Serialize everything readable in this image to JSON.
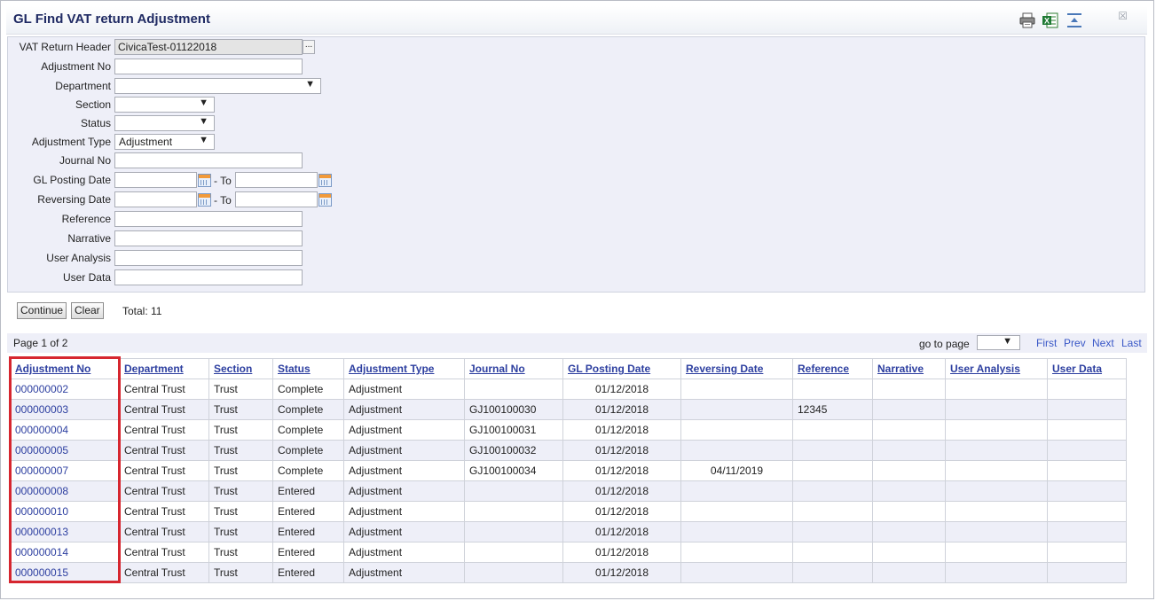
{
  "window": {
    "title": "GL Find VAT return Adjustment",
    "close_label": "☒"
  },
  "toolbar": {
    "icons": [
      "printer-icon",
      "excel-export-icon",
      "collapse-icon"
    ]
  },
  "form": {
    "vat_return_header": {
      "label": "VAT Return Header",
      "value": "CivicaTest-01122018",
      "lookup_label": "..."
    },
    "adjustment_no": {
      "label": "Adjustment No",
      "value": ""
    },
    "department": {
      "label": "Department",
      "value": ""
    },
    "section": {
      "label": "Section",
      "value": ""
    },
    "status": {
      "label": "Status",
      "value": ""
    },
    "adjustment_type": {
      "label": "Adjustment Type",
      "value": "Adjustment"
    },
    "journal_no": {
      "label": "Journal No",
      "value": ""
    },
    "gl_posting_date": {
      "label": "GL Posting Date",
      "from": "",
      "to_label": "- To",
      "to": ""
    },
    "reversing_date": {
      "label": "Reversing Date",
      "from": "",
      "to_label": "- To",
      "to": ""
    },
    "reference": {
      "label": "Reference",
      "value": ""
    },
    "narrative": {
      "label": "Narrative",
      "value": ""
    },
    "user_analysis": {
      "label": "User Analysis",
      "value": ""
    },
    "user_data": {
      "label": "User Data",
      "value": ""
    }
  },
  "actions": {
    "continue_label": "Continue",
    "clear_label": "Clear",
    "total_text": "Total: 11"
  },
  "pager": {
    "page_text": "Page 1 of 2",
    "goto_label": "go to page",
    "goto_value": "",
    "first": "First",
    "prev": "Prev",
    "next": "Next",
    "last": "Last"
  },
  "table": {
    "columns": [
      "Adjustment No",
      "Department",
      "Section",
      "Status",
      "Adjustment Type",
      "Journal No",
      "GL Posting Date",
      "Reversing Date",
      "Reference",
      "Narrative",
      "User Analysis",
      "User Data"
    ],
    "rows": [
      [
        "000000002",
        "Central Trust",
        "Trust",
        "Complete",
        "Adjustment",
        "",
        "01/12/2018",
        "",
        "",
        "",
        "",
        ""
      ],
      [
        "000000003",
        "Central Trust",
        "Trust",
        "Complete",
        "Adjustment",
        "GJ100100030",
        "01/12/2018",
        "",
        "12345",
        "",
        "",
        ""
      ],
      [
        "000000004",
        "Central Trust",
        "Trust",
        "Complete",
        "Adjustment",
        "GJ100100031",
        "01/12/2018",
        "",
        "",
        "",
        "",
        ""
      ],
      [
        "000000005",
        "Central Trust",
        "Trust",
        "Complete",
        "Adjustment",
        "GJ100100032",
        "01/12/2018",
        "",
        "",
        "",
        "",
        ""
      ],
      [
        "000000007",
        "Central Trust",
        "Trust",
        "Complete",
        "Adjustment",
        "GJ100100034",
        "01/12/2018",
        "04/11/2019",
        "",
        "",
        "",
        ""
      ],
      [
        "000000008",
        "Central Trust",
        "Trust",
        "Entered",
        "Adjustment",
        "",
        "01/12/2018",
        "",
        "",
        "",
        "",
        ""
      ],
      [
        "000000010",
        "Central Trust",
        "Trust",
        "Entered",
        "Adjustment",
        "",
        "01/12/2018",
        "",
        "",
        "",
        "",
        ""
      ],
      [
        "000000013",
        "Central Trust",
        "Trust",
        "Entered",
        "Adjustment",
        "",
        "01/12/2018",
        "",
        "",
        "",
        "",
        ""
      ],
      [
        "000000014",
        "Central Trust",
        "Trust",
        "Entered",
        "Adjustment",
        "",
        "01/12/2018",
        "",
        "",
        "",
        "",
        ""
      ],
      [
        "000000015",
        "Central Trust",
        "Trust",
        "Entered",
        "Adjustment",
        "",
        "01/12/2018",
        "",
        "",
        "",
        "",
        ""
      ]
    ]
  },
  "colors": {
    "accent": "#2d3fa0",
    "panel": "#eeeff8",
    "highlight": "#d6262f"
  }
}
